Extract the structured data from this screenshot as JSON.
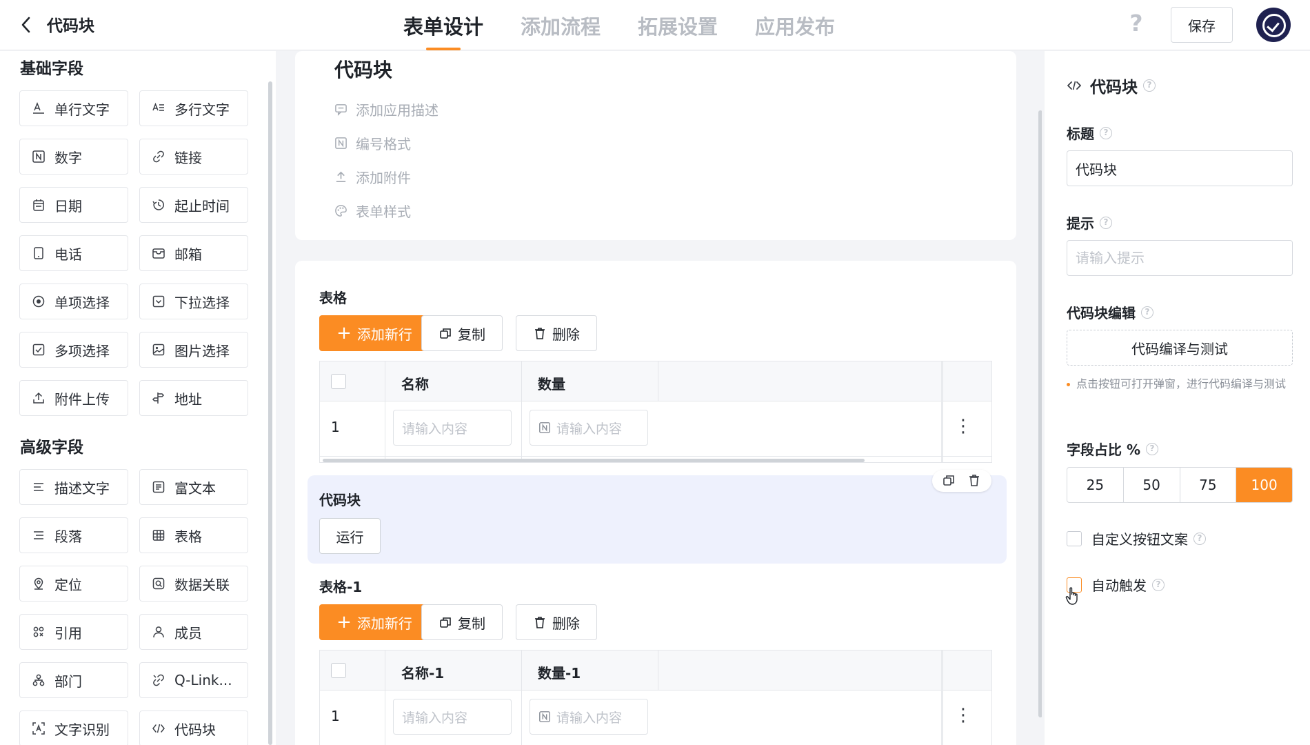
{
  "header": {
    "app_title": "代码块",
    "tabs": [
      "表单设计",
      "添加流程",
      "拓展设置",
      "应用发布"
    ],
    "active_tab": "表单设计",
    "help": "?",
    "save_label": "保存"
  },
  "palette": {
    "basic_title": "基础字段",
    "basic_fields": [
      {
        "label": "单行文字",
        "icon": "single-line-text-icon"
      },
      {
        "label": "多行文字",
        "icon": "multi-line-text-icon"
      },
      {
        "label": "数字",
        "icon": "number-icon"
      },
      {
        "label": "链接",
        "icon": "link-icon"
      },
      {
        "label": "日期",
        "icon": "calendar-icon"
      },
      {
        "label": "起止时间",
        "icon": "time-range-icon"
      },
      {
        "label": "电话",
        "icon": "phone-icon"
      },
      {
        "label": "邮箱",
        "icon": "mail-icon"
      },
      {
        "label": "单项选择",
        "icon": "radio-icon"
      },
      {
        "label": "下拉选择",
        "icon": "dropdown-icon"
      },
      {
        "label": "多项选择",
        "icon": "checkbox-icon"
      },
      {
        "label": "图片选择",
        "icon": "image-icon"
      },
      {
        "label": "附件上传",
        "icon": "upload-icon"
      },
      {
        "label": "地址",
        "icon": "address-icon"
      }
    ],
    "advanced_title": "高级字段",
    "advanced_fields": [
      {
        "label": "描述文字",
        "icon": "description-icon"
      },
      {
        "label": "富文本",
        "icon": "rich-text-icon"
      },
      {
        "label": "段落",
        "icon": "paragraph-icon"
      },
      {
        "label": "表格",
        "icon": "table-icon"
      },
      {
        "label": "定位",
        "icon": "location-icon"
      },
      {
        "label": "数据关联",
        "icon": "data-link-icon"
      },
      {
        "label": "引用",
        "icon": "reference-icon"
      },
      {
        "label": "成员",
        "icon": "member-icon"
      },
      {
        "label": "部门",
        "icon": "department-icon"
      },
      {
        "label": "Q-Link...",
        "icon": "qlink-icon"
      },
      {
        "label": "文字识别",
        "icon": "ocr-icon"
      },
      {
        "label": "代码块",
        "icon": "code-icon"
      }
    ]
  },
  "form": {
    "title": "代码块",
    "meta": [
      {
        "label": "添加应用描述",
        "icon": "comment-icon"
      },
      {
        "label": "编号格式",
        "icon": "number-format-icon"
      },
      {
        "label": "添加附件",
        "icon": "attachment-icon"
      },
      {
        "label": "表单样式",
        "icon": "palette-icon"
      }
    ],
    "table1": {
      "label": "表格",
      "add_row": "添加新行",
      "copy": "复制",
      "delete": "删除",
      "columns": [
        "名称",
        "数量"
      ],
      "row_num": "1",
      "placeholder": "请输入内容"
    },
    "code_block": {
      "label": "代码块",
      "run": "运行"
    },
    "table2": {
      "label": "表格-1",
      "add_row": "添加新行",
      "copy": "复制",
      "delete": "删除",
      "columns": [
        "名称-1",
        "数量-1"
      ],
      "row_num": "1",
      "placeholder": "请输入内容"
    }
  },
  "props": {
    "title": "代码块",
    "title_label": "标题",
    "title_value": "代码块",
    "tip_label": "提示",
    "tip_placeholder": "请输入提示",
    "code_edit_label": "代码块编辑",
    "code_edit_button": "代码编译与测试",
    "code_edit_hint": "点击按钮可打开弹窗，进行代码编译与测试",
    "width_label": "字段占比 %",
    "width_options": [
      "25",
      "50",
      "75",
      "100"
    ],
    "width_selected": "100",
    "custom_button_text": "自定义按钮文案",
    "auto_trigger": "自动触发"
  },
  "colors": {
    "accent": "#fb8c23",
    "code_block_bg": "#eef1fd"
  }
}
